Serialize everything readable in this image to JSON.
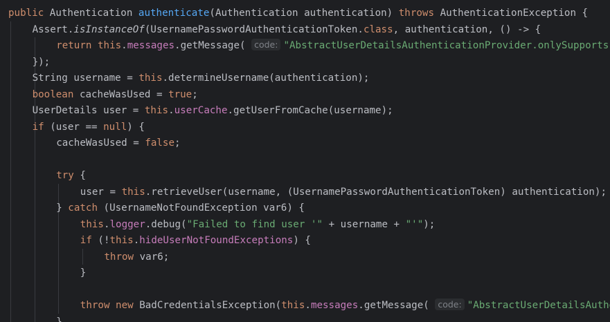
{
  "editor": {
    "lines": [
      {
        "indent": 0,
        "tokens": [
          {
            "c": "kw",
            "t": "public "
          },
          {
            "c": "plain",
            "t": "Authentication "
          },
          {
            "c": "fn",
            "t": "authenticate"
          },
          {
            "c": "plain",
            "t": "(Authentication authentication) "
          },
          {
            "c": "kw",
            "t": "throws "
          },
          {
            "c": "plain",
            "t": "AuthenticationException {"
          }
        ]
      },
      {
        "indent": 1,
        "tokens": [
          {
            "c": "plain",
            "t": "Assert."
          },
          {
            "c": "static",
            "t": "isInstanceOf"
          },
          {
            "c": "plain",
            "t": "(UsernamePasswordAuthenticationToken."
          },
          {
            "c": "kw",
            "t": "class"
          },
          {
            "c": "plain",
            "t": ", authentication, () -> {"
          }
        ]
      },
      {
        "indent": 2,
        "tokens": [
          {
            "c": "kw",
            "t": "return "
          },
          {
            "c": "kw",
            "t": "this"
          },
          {
            "c": "plain",
            "t": "."
          },
          {
            "c": "field",
            "t": "messages"
          },
          {
            "c": "plain",
            "t": ".getMessage( "
          },
          {
            "c": "hint",
            "t": "code:"
          },
          {
            "c": "str",
            "t": "\"AbstractUserDetailsAuthenticationProvider.onlySupports"
          }
        ]
      },
      {
        "indent": 1,
        "tokens": [
          {
            "c": "plain",
            "t": "});"
          }
        ]
      },
      {
        "indent": 1,
        "tokens": [
          {
            "c": "plain",
            "t": "String username = "
          },
          {
            "c": "kw",
            "t": "this"
          },
          {
            "c": "plain",
            "t": ".determineUsername(authentication);"
          }
        ]
      },
      {
        "indent": 1,
        "tokens": [
          {
            "c": "kw",
            "t": "boolean "
          },
          {
            "c": "plain",
            "t": "cacheWasUsed = "
          },
          {
            "c": "kw",
            "t": "true"
          },
          {
            "c": "plain",
            "t": ";"
          }
        ]
      },
      {
        "indent": 1,
        "tokens": [
          {
            "c": "plain",
            "t": "UserDetails user = "
          },
          {
            "c": "kw",
            "t": "this"
          },
          {
            "c": "plain",
            "t": "."
          },
          {
            "c": "field",
            "t": "userCache"
          },
          {
            "c": "plain",
            "t": ".getUserFromCache(username);"
          }
        ]
      },
      {
        "indent": 1,
        "tokens": [
          {
            "c": "kw",
            "t": "if "
          },
          {
            "c": "plain",
            "t": "(user == "
          },
          {
            "c": "kw",
            "t": "null"
          },
          {
            "c": "plain",
            "t": ") {"
          }
        ]
      },
      {
        "indent": 2,
        "tokens": [
          {
            "c": "plain",
            "t": "cacheWasUsed = "
          },
          {
            "c": "kw",
            "t": "false"
          },
          {
            "c": "plain",
            "t": ";"
          }
        ]
      },
      {
        "indent": 0,
        "tokens": []
      },
      {
        "indent": 2,
        "tokens": [
          {
            "c": "kw",
            "t": "try "
          },
          {
            "c": "plain",
            "t": "{"
          }
        ]
      },
      {
        "indent": 3,
        "tokens": [
          {
            "c": "plain",
            "t": "user = "
          },
          {
            "c": "kw",
            "t": "this"
          },
          {
            "c": "plain",
            "t": ".retrieveUser(username, (UsernamePasswordAuthenticationToken) authentication);"
          }
        ]
      },
      {
        "indent": 2,
        "tokens": [
          {
            "c": "plain",
            "t": "} "
          },
          {
            "c": "kw",
            "t": "catch "
          },
          {
            "c": "plain",
            "t": "(UsernameNotFoundException var6) {"
          }
        ]
      },
      {
        "indent": 3,
        "tokens": [
          {
            "c": "kw",
            "t": "this"
          },
          {
            "c": "plain",
            "t": "."
          },
          {
            "c": "field",
            "t": "logger"
          },
          {
            "c": "plain",
            "t": ".debug("
          },
          {
            "c": "str",
            "t": "\"Failed to find user '\""
          },
          {
            "c": "plain",
            "t": " + username + "
          },
          {
            "c": "str",
            "t": "\"'\""
          },
          {
            "c": "plain",
            "t": ");"
          }
        ]
      },
      {
        "indent": 3,
        "tokens": [
          {
            "c": "kw",
            "t": "if "
          },
          {
            "c": "plain",
            "t": "(!"
          },
          {
            "c": "kw",
            "t": "this"
          },
          {
            "c": "plain",
            "t": "."
          },
          {
            "c": "field",
            "t": "hideUserNotFoundExceptions"
          },
          {
            "c": "plain",
            "t": ") {"
          }
        ]
      },
      {
        "indent": 4,
        "tokens": [
          {
            "c": "kw",
            "t": "throw "
          },
          {
            "c": "plain",
            "t": "var6;"
          }
        ]
      },
      {
        "indent": 3,
        "tokens": [
          {
            "c": "plain",
            "t": "}"
          }
        ]
      },
      {
        "indent": 0,
        "tokens": []
      },
      {
        "indent": 3,
        "tokens": [
          {
            "c": "kw",
            "t": "throw new "
          },
          {
            "c": "plain",
            "t": "BadCredentialsException("
          },
          {
            "c": "kw",
            "t": "this"
          },
          {
            "c": "plain",
            "t": "."
          },
          {
            "c": "field",
            "t": "messages"
          },
          {
            "c": "plain",
            "t": ".getMessage( "
          },
          {
            "c": "hint",
            "t": "code:"
          },
          {
            "c": "str",
            "t": "\"AbstractUserDetailsAuthe"
          }
        ]
      },
      {
        "indent": 2,
        "tokens": [
          {
            "c": "plain",
            "t": "}"
          }
        ]
      }
    ]
  },
  "colors": {
    "background": "#1e1f22",
    "keyword": "#cf8e6d",
    "method": "#56a8f5",
    "field": "#c77dbb",
    "string": "#6aab73",
    "text": "#bcbec4",
    "hint_bg": "#2b2d30",
    "hint_text": "#7f8288",
    "indent_guide": "#393b40"
  }
}
